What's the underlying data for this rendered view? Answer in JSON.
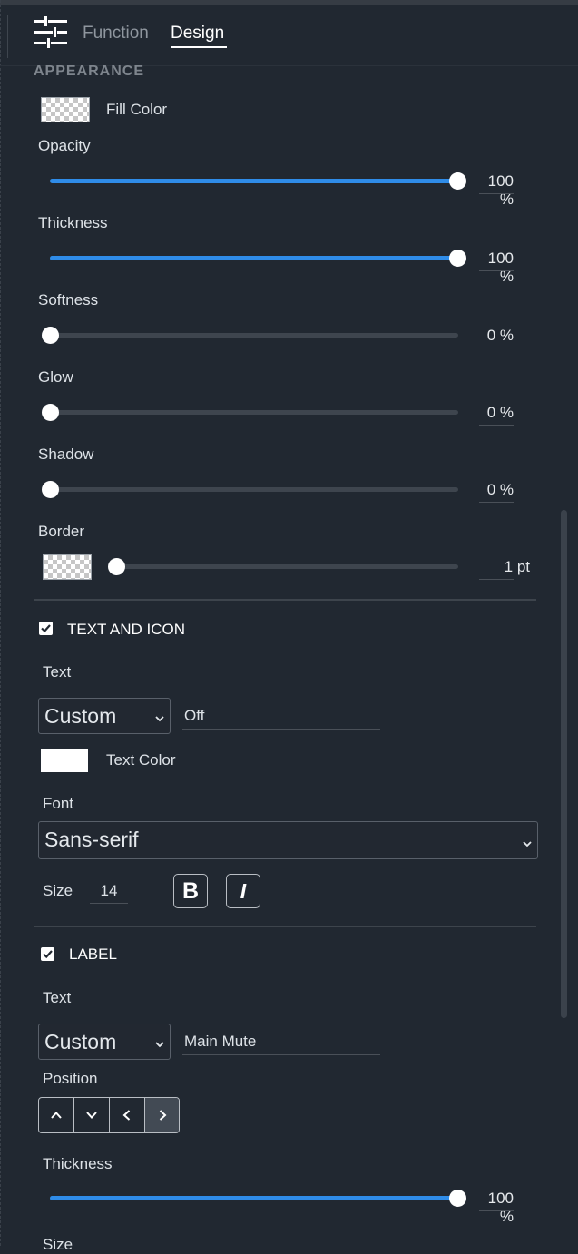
{
  "tabs": {
    "function": "Function",
    "design": "Design",
    "active": "Design"
  },
  "appearance": {
    "header": "APPEARANCE",
    "fill_color_label": "Fill Color",
    "opacity": {
      "label": "Opacity",
      "value": "100 %",
      "level": 100
    },
    "thickness": {
      "label": "Thickness",
      "value": "100 %",
      "level": 100
    },
    "softness": {
      "label": "Softness",
      "value": "0 %",
      "level": 0
    },
    "glow": {
      "label": "Glow",
      "value": "0 %",
      "level": 0
    },
    "shadow": {
      "label": "Shadow",
      "value": "0 %",
      "level": 0
    },
    "border": {
      "label": "Border",
      "value": "1 pt",
      "level": 0
    }
  },
  "text_and_icon": {
    "title": "TEXT AND ICON",
    "checked": true,
    "text_label": "Text",
    "text_mode": "Custom",
    "text_value": "Off",
    "text_color_label": "Text Color",
    "text_color": "#ffffff",
    "font_label": "Font",
    "font_value": "Sans-serif",
    "size_label": "Size",
    "size_value": "14",
    "bold_label": "B",
    "italic_label": "I"
  },
  "label_section": {
    "title": "LABEL",
    "checked": true,
    "text_label": "Text",
    "text_mode": "Custom",
    "text_value": "Main Mute",
    "position_label": "Position",
    "position_selected": "right",
    "thickness": {
      "label": "Thickness",
      "value": "100 %",
      "level": 100
    },
    "size_label": "Size"
  },
  "colors": {
    "accent": "#2f8ce8",
    "background": "#212831"
  }
}
